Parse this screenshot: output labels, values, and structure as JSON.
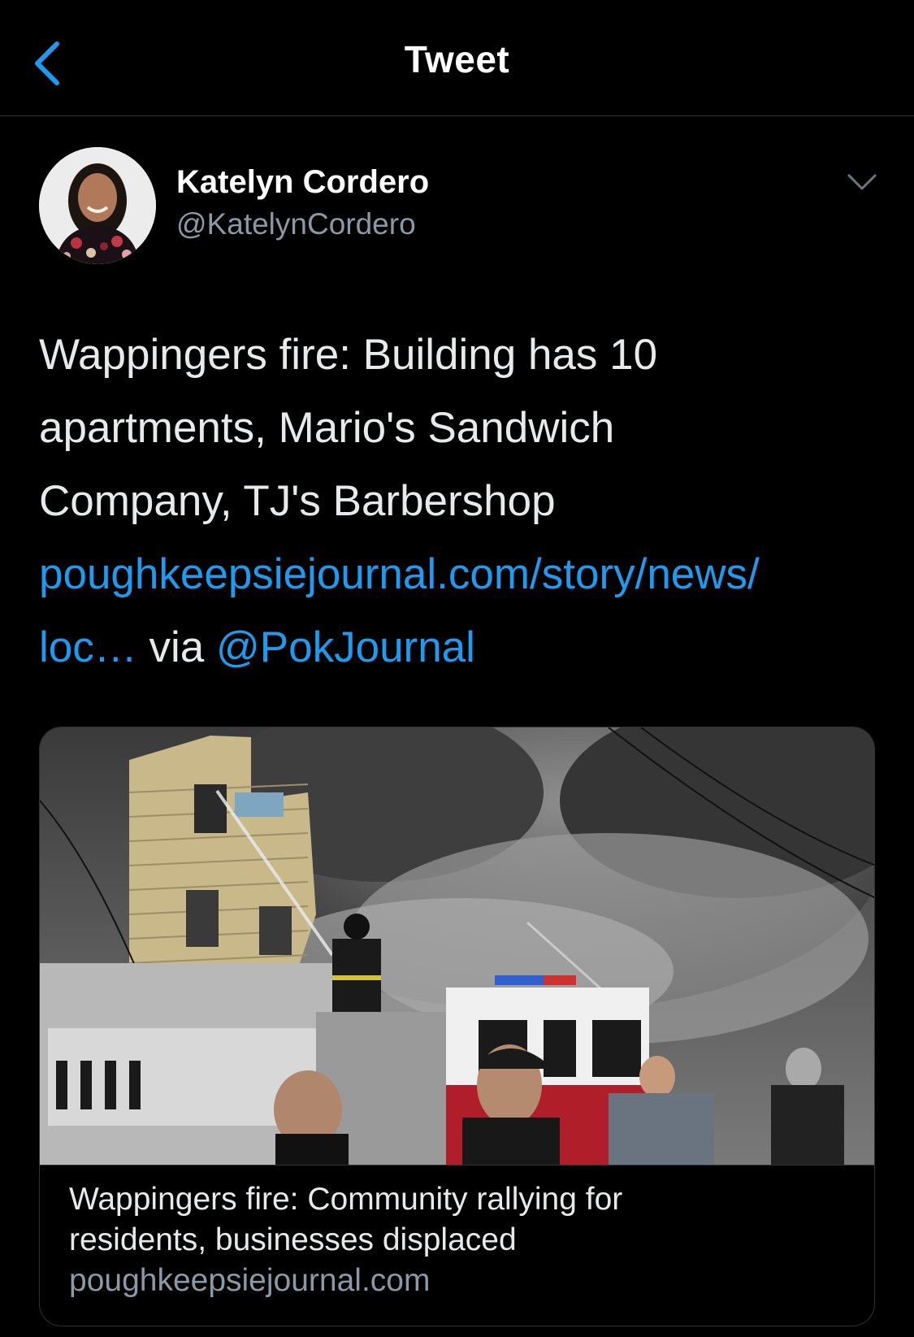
{
  "header": {
    "title": "Tweet",
    "back_icon": "chevron-left-icon"
  },
  "colors": {
    "accent": "#1d9bf0",
    "background": "#000000",
    "text_primary": "#e7e9ea",
    "text_secondary": "#8b98a5",
    "border": "#2f3336"
  },
  "author": {
    "name": "Katelyn Cordero",
    "handle": "@KatelynCordero",
    "avatar_icon": "avatar"
  },
  "tweet": {
    "text_line1": "Wappingers fire: Building has 10",
    "text_line2": "apartments, Mario's Sandwich",
    "text_line3": "Company, TJ's Barbershop",
    "link": "poughkeepsiejournal.com/story/news/loc…",
    "link_part1": "poughkeepsiejournal.com/story/news/",
    "link_part2": "loc…",
    "via": " via ",
    "mention": "@PokJournal"
  },
  "card": {
    "title_line1": "Wappingers fire: Community rallying for",
    "title_line2": "residents, businesses displaced",
    "domain": "poughkeepsiejournal.com",
    "image_description_icon": "news-photo"
  }
}
